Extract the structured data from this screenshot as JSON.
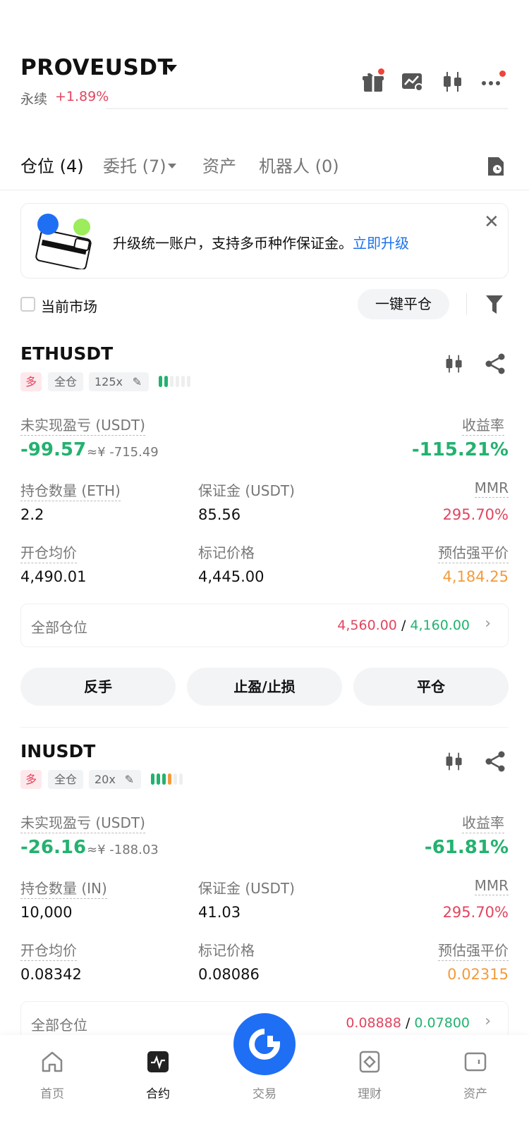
{
  "header": {
    "symbol": "PROVEUSDT",
    "perp_label": "永续",
    "change": "+1.89%"
  },
  "tabs": [
    {
      "label": "仓位 (4)"
    },
    {
      "label": "委托 (7)"
    },
    {
      "label": "资产"
    },
    {
      "label": "机器人 (0)"
    }
  ],
  "banner": {
    "text": "升级统一账户，支持多币种作保证金。",
    "link": "立即升级"
  },
  "filter_bar": {
    "checkbox_label": "当前市场",
    "close_all": "一键平仓"
  },
  "positions": [
    {
      "symbol": "ETHUSDT",
      "side": "多",
      "margin_mode": "全仓",
      "leverage": "125x",
      "adl_level": 2,
      "pnl_label": "未实现盈亏 (USDT)",
      "pnl": "-99.57",
      "pnl_cny": "≈¥ -715.49",
      "roe_label": "收益率",
      "roe": "-115.21%",
      "qty_label": "持仓数量 (ETH)",
      "qty": "2.2",
      "margin_label": "保证金 (USDT)",
      "margin": "85.56",
      "mmr_label": "MMR",
      "mmr": "295.70%",
      "entry_label": "开仓均价",
      "entry": "4,490.01",
      "mark_label": "标记价格",
      "mark": "4,445.00",
      "liq_label": "预估强平价",
      "liq": "4,184.25",
      "all_label": "全部仓位",
      "tp": "4,560.00",
      "sl": "4,160.00",
      "sep": "/"
    },
    {
      "symbol": "INUSDT",
      "side": "多",
      "margin_mode": "全仓",
      "leverage": "20x",
      "adl_level": 4,
      "pnl_label": "未实现盈亏 (USDT)",
      "pnl": "-26.16",
      "pnl_cny": "≈¥ -188.03",
      "roe_label": "收益率",
      "roe": "-61.81%",
      "qty_label": "持仓数量 (IN)",
      "qty": "10,000",
      "margin_label": "保证金 (USDT)",
      "margin": "41.03",
      "mmr_label": "MMR",
      "mmr": "295.70%",
      "entry_label": "开仓均价",
      "entry": "0.08342",
      "mark_label": "标记价格",
      "mark": "0.08086",
      "liq_label": "预估强平价",
      "liq": "0.02315",
      "all_label": "全部仓位",
      "tp": "0.08888",
      "sl": "0.07800",
      "sep": "/"
    }
  ],
  "actions": {
    "reverse": "反手",
    "tpsl": "止盈/止损",
    "close": "平仓"
  },
  "bottom_nav": [
    {
      "label": "首页",
      "icon": "home-icon"
    },
    {
      "label": "合约",
      "icon": "futures-icon"
    },
    {
      "label": "交易",
      "icon": "trade-icon"
    },
    {
      "label": "理财",
      "icon": "earn-icon"
    },
    {
      "label": "资产",
      "icon": "assets-icon"
    }
  ],
  "colors": {
    "green": "#23b26f",
    "red": "#e2455f",
    "orange": "#f39b3c",
    "blue": "#1a72ee"
  }
}
